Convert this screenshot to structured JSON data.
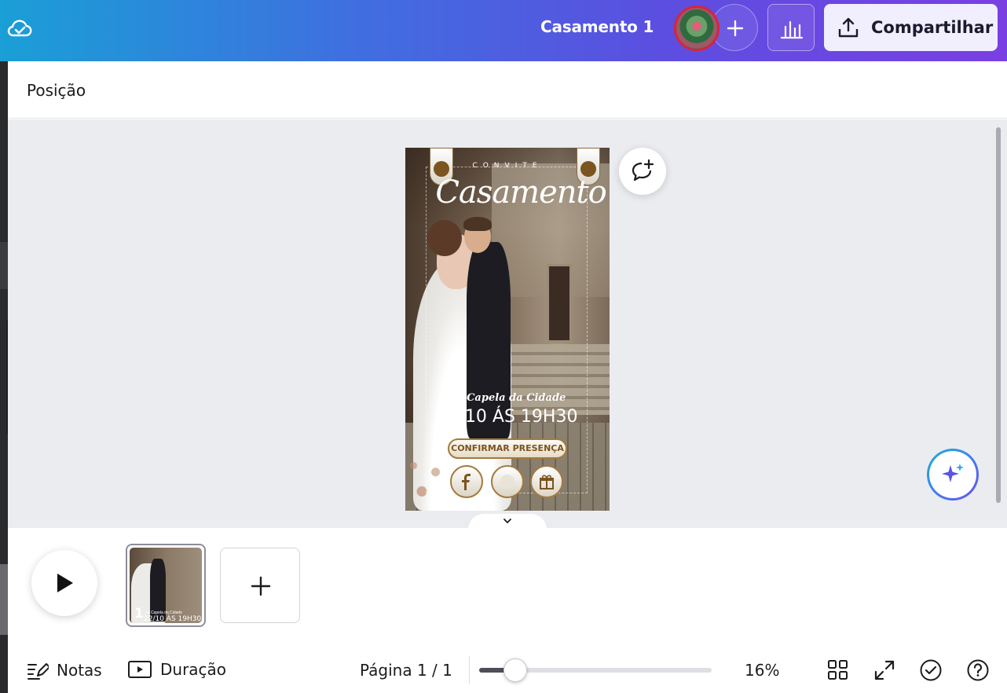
{
  "topbar": {
    "title": "Casamento 1",
    "share_label": "Compartilhar"
  },
  "position_panel": {
    "label": "Posição"
  },
  "design": {
    "header_small": "CONVITE",
    "script_title": "Casamento",
    "place": "na Capela da Cidade",
    "datetime": "22/10 ÁS 19H30",
    "rsvp_label": "CONFIRMAR PRESENÇA",
    "social_icons": [
      "facebook-icon",
      "music-icon",
      "gift-icon"
    ]
  },
  "timeline": {
    "page_number": "1",
    "thumb_place": "na Capela da Cidade",
    "thumb_datetime": "22/10 ÁS 19H30"
  },
  "footer": {
    "notes_label": "Notas",
    "duration_label": "Duração",
    "page_indicator": "Página 1 / 1",
    "zoom_label": "16%",
    "zoom_level": 0.16
  },
  "colors": {
    "topbar_gradient_start": "#1a9fd6",
    "topbar_gradient_end": "#7a3fe3",
    "share_button_bg": "#f1eefe",
    "canvas_bg": "#ebecf0",
    "gold_accent": "#a37a3e"
  }
}
